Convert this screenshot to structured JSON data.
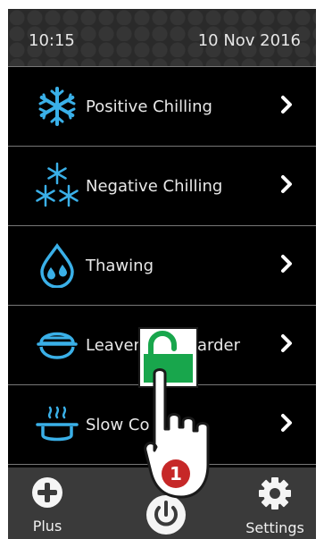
{
  "status": {
    "time": "10:15",
    "date": "10 Nov 2016"
  },
  "menu": {
    "items": [
      {
        "label": "Positive Chilling",
        "icon": "snowflake-icon"
      },
      {
        "label": "Negative Chilling",
        "icon": "triple-snowflake-icon"
      },
      {
        "label": "Thawing",
        "icon": "water-drop-icon"
      },
      {
        "label": "Leaven",
        "label_tail": "arder",
        "icon": "dough-bowl-icon"
      },
      {
        "label": "Slow Co",
        "label_tail": "",
        "icon": "steaming-pot-icon"
      }
    ]
  },
  "bottom": {
    "plus_label": "Plus",
    "settings_label": "Settings"
  },
  "overlay": {
    "step_number": "1"
  },
  "colors": {
    "accent_blue": "#3ab0e8",
    "lock_green": "#18a64c",
    "badge_red": "#c62828"
  }
}
